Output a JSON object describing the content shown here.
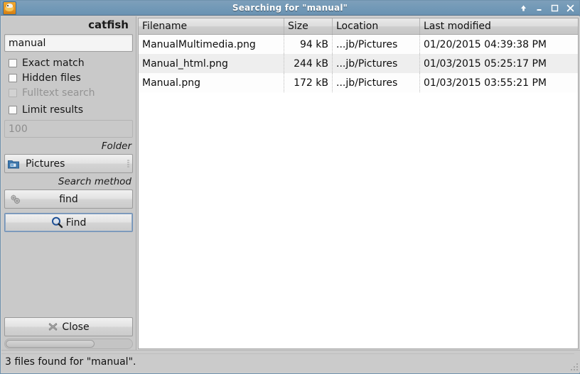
{
  "window": {
    "title": "Searching for \"manual\"",
    "app_icon": "catfish-icon",
    "buttons": [
      {
        "name": "shade-button",
        "glyph": "↑"
      },
      {
        "name": "minimize-button",
        "glyph": "_"
      },
      {
        "name": "maximize-button",
        "glyph": "□"
      },
      {
        "name": "close-button",
        "glyph": "✕"
      }
    ],
    "titlebar_color": "#7299b7"
  },
  "sidebar": {
    "app_name": "catfish",
    "search": {
      "value": "manual",
      "placeholder": "Search..."
    },
    "options": [
      {
        "label": "Exact match",
        "checked": false,
        "disabled": false
      },
      {
        "label": "Hidden files",
        "checked": false,
        "disabled": false
      },
      {
        "label": "Fulltext search",
        "checked": false,
        "disabled": true
      },
      {
        "label": "Limit results",
        "checked": false,
        "disabled": false
      }
    ],
    "limit": {
      "value": "100",
      "disabled": true
    },
    "folder_group_label": "Folder",
    "folder": {
      "value": "Pictures",
      "icon": "folder-icon"
    },
    "method_group_label": "Search method",
    "method": {
      "value": "find",
      "icon": "gears-icon"
    },
    "find_button": {
      "label": "Find",
      "icon": "magnifier-icon",
      "focused": true
    },
    "close_button": {
      "label": "Close",
      "icon": "close-x-icon"
    }
  },
  "results": {
    "columns": [
      "Filename",
      "Size",
      "Location",
      "Last modified"
    ],
    "rows": [
      {
        "filename": "ManualMultimedia.png",
        "size": "94 kB",
        "location": "...jb/Pictures",
        "modified": "01/20/2015 04:39:38 PM"
      },
      {
        "filename": "Manual_html.png",
        "size": "244 kB",
        "location": "...jb/Pictures",
        "modified": "01/03/2015 05:25:17 PM"
      },
      {
        "filename": "Manual.png",
        "size": "172 kB",
        "location": "...jb/Pictures",
        "modified": "01/03/2015 03:55:21 PM"
      }
    ]
  },
  "statusbar": {
    "text": "3 files found for \"manual\"."
  }
}
